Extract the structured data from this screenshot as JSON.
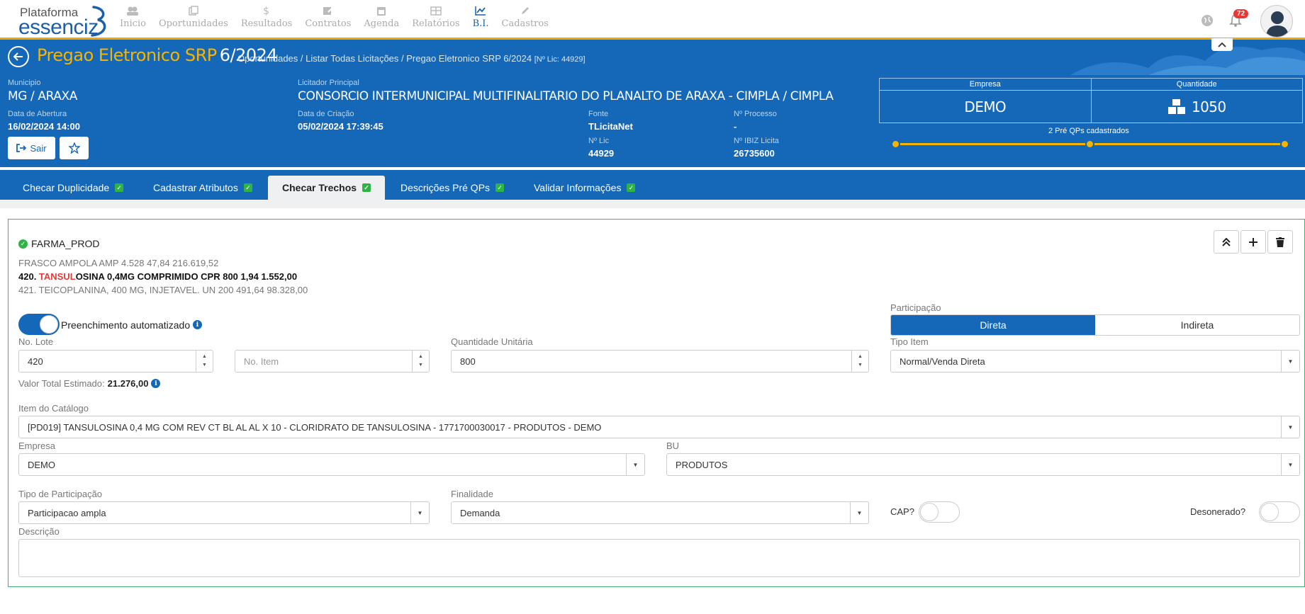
{
  "brand": {
    "line1": "Plataforma",
    "line2": "essenciz"
  },
  "menu": [
    {
      "label": "Inicio",
      "icon": "users-icon"
    },
    {
      "label": "Oportunidades",
      "icon": "copy-icon"
    },
    {
      "label": "Resultados",
      "icon": "dollar-icon"
    },
    {
      "label": "Contratos",
      "icon": "edit-icon"
    },
    {
      "label": "Agenda",
      "icon": "calendar-icon"
    },
    {
      "label": "Relatórios",
      "icon": "table-icon"
    },
    {
      "label": "B.I.",
      "icon": "chart-line-icon"
    },
    {
      "label": "Cadastros",
      "icon": "pencil-icon"
    }
  ],
  "notifications": {
    "count": "72"
  },
  "header": {
    "title": "Pregao Eletronico SRP",
    "number": "6/2024",
    "breadcrumb": {
      "a": "Oportunidades",
      "b": "Listar Todas Licitações",
      "c": "Pregao Eletronico SRP 6/2024",
      "c_small": "[Nº Lic: 44929]"
    },
    "municipio_label": "Municipio",
    "municipio": "MG / ARAXA",
    "licitador_label": "Licitador Principal",
    "licitador": "CONSORCIO INTERMUNICIPAL MULTIFINALITARIO DO PLANALTO DE ARAXA - CIMPLA / CIMPLA",
    "abertura_label": "Data de Abertura",
    "abertura": "16/02/2024 14:00",
    "criacao_label": "Data de Criação",
    "criacao": "05/02/2024 17:39:45",
    "fonte_label": "Fonte",
    "fonte": "TLicitaNet",
    "processo_label": "Nº Processo",
    "processo": "-",
    "nlic_label": "Nº Lic",
    "nlic": "44929",
    "ibiz_label": "Nº IBIZ Licita",
    "ibiz": "26735600",
    "sair": "Sair",
    "empresa_label": "Empresa",
    "empresa": "DEMO",
    "quantidade_label": "Quantidade",
    "quantidade": "1050",
    "preqps": "2 Pré QPs cadastrados"
  },
  "tabs": [
    {
      "label": "Checar Duplicidade"
    },
    {
      "label": "Cadastrar Atributos"
    },
    {
      "label": "Checar Trechos"
    },
    {
      "label": "Descrições Pré QPs"
    },
    {
      "label": "Validar Informações"
    }
  ],
  "card": {
    "tag": "FARMA_PROD",
    "line1": "FRASCO AMPOLA AMP 4.528 47,84 216.619,52",
    "line2_prefix": "420. ",
    "line2_highlight": "TANSUL",
    "line2_rest": "OSINA 0,4MG COMPRIMIDO CPR 800 1,94 1.552,00",
    "line3": "421. TEICOPLANINA, 400 MG, INJETAVEL. UN 200 491,64 98.328,00",
    "auto_label": "Preenchimento automatizado",
    "participacao_label": "Participação",
    "participacao_options": [
      "Direta",
      "Indireta"
    ],
    "lote_label": "No. Lote",
    "lote": "420",
    "item_placeholder": "No. Item",
    "qtd_label": "Quantidade Unitária",
    "qtd": "800",
    "tipo_item_label": "Tipo Item",
    "tipo_item": "Normal/Venda Direta",
    "valor_label": "Valor Total Estimado:",
    "valor": "21.276,00",
    "catalogo_label": "Item do Catálogo",
    "catalogo": "[PD019] TANSULOSINA 0,4 MG COM REV CT BL AL AL X 10 - CLORIDRATO DE TANSULOSINA - 1771700030017 - PRODUTOS - DEMO",
    "empresa_label": "Empresa",
    "empresa": "DEMO",
    "bu_label": "BU",
    "bu": "PRODUTOS",
    "tipo_part_label": "Tipo de Participação",
    "tipo_part": "Participacao ampla",
    "finalidade_label": "Finalidade",
    "finalidade": "Demanda",
    "cap_label": "CAP?",
    "desonerado_label": "Desonerado?",
    "descricao_label": "Descrição"
  },
  "colors": {
    "primary": "#1567b8",
    "accent": "#f5b400",
    "success": "#2fb344",
    "highlight": "#e53935"
  }
}
